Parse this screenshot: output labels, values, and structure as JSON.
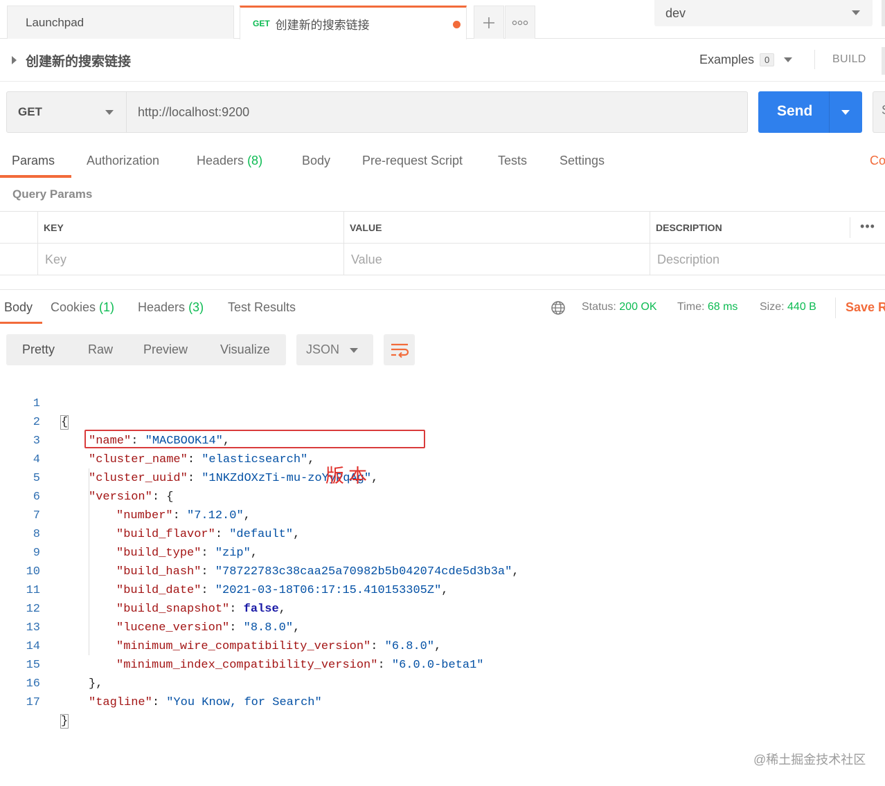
{
  "tabs": {
    "launchpad": "Launchpad",
    "active_method": "GET",
    "active_title": "创建新的搜索链接",
    "plus_glyph": "+",
    "more_glyph": "ooo"
  },
  "environment": {
    "selected": "dev"
  },
  "request": {
    "title": "创建新的搜索链接",
    "examples_label": "Examples",
    "examples_count": "0",
    "build_label": "BUILD",
    "method": "GET",
    "url": "http://localhost:9200",
    "send_label": "Send",
    "save_partial": "S"
  },
  "request_tabs": {
    "params": "Params",
    "authorization": "Authorization",
    "headers": "Headers",
    "headers_count": "(8)",
    "body": "Body",
    "prerequest": "Pre-request Script",
    "tests": "Tests",
    "settings": "Settings",
    "cookies_partial": "Co"
  },
  "query_params": {
    "label": "Query Params",
    "columns": {
      "key": "KEY",
      "value": "VALUE",
      "description": "DESCRIPTION"
    },
    "placeholders": {
      "key": "Key",
      "value": "Value",
      "description": "Description"
    },
    "more_glyph": "•••"
  },
  "response_tabs": {
    "body": "Body",
    "cookies": "Cookies",
    "cookies_count": "(1)",
    "headers": "Headers",
    "headers_count": "(3)",
    "test_results": "Test Results"
  },
  "response_meta": {
    "status_label": "Status:",
    "status_value": "200 OK",
    "time_label": "Time:",
    "time_value": "68 ms",
    "size_label": "Size:",
    "size_value": "440 B",
    "save_label": "Save R"
  },
  "view_options": {
    "pretty": "Pretty",
    "raw": "Raw",
    "preview": "Preview",
    "visualize": "Visualize",
    "language": "JSON"
  },
  "code": {
    "line_numbers": [
      "1",
      "2",
      "3",
      "4",
      "5",
      "6",
      "7",
      "8",
      "9",
      "10",
      "11",
      "12",
      "13",
      "14",
      "15",
      "16",
      "17"
    ],
    "open_brace": "{",
    "close_brace": "}",
    "name_key": "\"name\"",
    "name_val": "\"MACBOOK14\"",
    "cluster_name_key": "\"cluster_name\"",
    "cluster_name_val": "\"elasticsearch\"",
    "cluster_uuid_key": "\"cluster_uuid\"",
    "cluster_uuid_val": "\"1NKZdOXzTi-mu-zoYyPqAg\"",
    "version_key": "\"version\"",
    "number_key": "\"number\"",
    "number_val": "\"7.12.0\"",
    "build_flavor_key": "\"build_flavor\"",
    "build_flavor_val": "\"default\"",
    "build_type_key": "\"build_type\"",
    "build_type_val": "\"zip\"",
    "build_hash_key": "\"build_hash\"",
    "build_hash_val": "\"78722783c38caa25a70982b5b042074cde5d3b3a\"",
    "build_date_key": "\"build_date\"",
    "build_date_val": "\"2021-03-18T06:17:15.410153305Z\"",
    "build_snapshot_key": "\"build_snapshot\"",
    "build_snapshot_val": "false",
    "lucene_version_key": "\"lucene_version\"",
    "lucene_version_val": "\"8.8.0\"",
    "min_wire_key": "\"minimum_wire_compatibility_version\"",
    "min_wire_val": "\"6.8.0\"",
    "min_index_key": "\"minimum_index_compatibility_version\"",
    "min_index_val": "\"6.0.0-beta1\"",
    "tagline_key": "\"tagline\"",
    "tagline_val": "\"You Know, for Search\""
  },
  "annotation": "版本",
  "watermark": "@稀土掘金技术社区",
  "colors": {
    "accent": "#f26b3a",
    "send": "#2f80ed",
    "success": "#0cbb52",
    "annotation": "#e0302a"
  }
}
